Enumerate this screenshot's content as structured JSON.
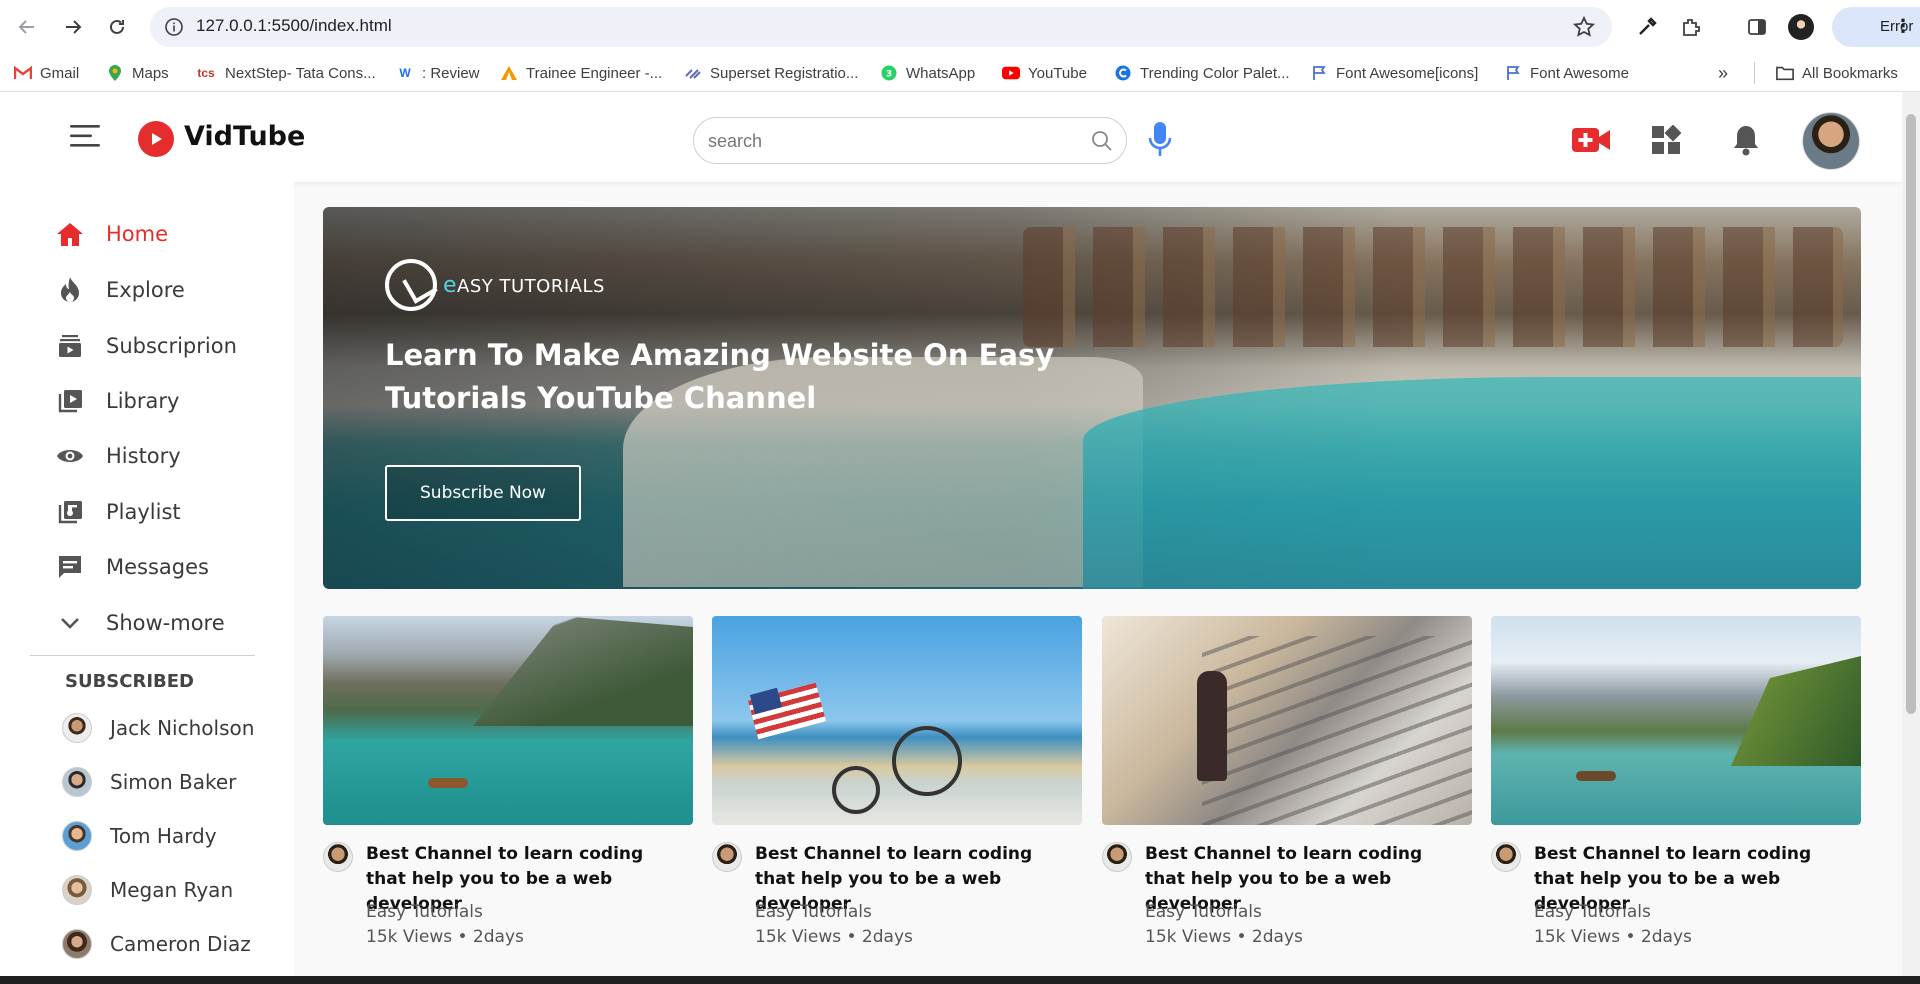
{
  "browser": {
    "url": "127.0.0.1:5500/index.html",
    "profile_status": "Error",
    "bookmarks": [
      {
        "label": "Gmail",
        "icon": "gmail-icon"
      },
      {
        "label": "Maps",
        "icon": "maps-icon"
      },
      {
        "label": "NextStep- Tata Cons...",
        "icon": "tcs-icon"
      },
      {
        "label": ": Review",
        "icon": "w-icon"
      },
      {
        "label": "Trainee Engineer -...",
        "icon": "triangle-icon"
      },
      {
        "label": "Superset Registratio...",
        "icon": "superset-icon"
      },
      {
        "label": "WhatsApp",
        "icon": "whatsapp-icon"
      },
      {
        "label": "YouTube",
        "icon": "youtube-icon"
      },
      {
        "label": "Trending Color Palet...",
        "icon": "c-icon"
      },
      {
        "label": "Font Awesome[icons]",
        "icon": "flag-icon"
      },
      {
        "label": "Font Awesome",
        "icon": "flag-icon"
      }
    ],
    "all_bookmarks": "All Bookmarks"
  },
  "header": {
    "brand": "VidTube",
    "search_placeholder": "search"
  },
  "sidebar": {
    "links": [
      {
        "label": "Home",
        "icon": "home-icon",
        "active": true
      },
      {
        "label": "Explore",
        "icon": "flame-icon",
        "active": false
      },
      {
        "label": "Subscriprion",
        "icon": "subscriptions-icon",
        "active": false
      },
      {
        "label": "Library",
        "icon": "library-icon",
        "active": false
      },
      {
        "label": "History",
        "icon": "eye-icon",
        "active": false
      },
      {
        "label": "Playlist",
        "icon": "playlist-icon",
        "active": false
      },
      {
        "label": "Messages",
        "icon": "chat-icon",
        "active": false
      },
      {
        "label": "Show-more",
        "icon": "chevron-down-icon",
        "active": false
      }
    ],
    "subscribed_heading": "SUBSCRIBED",
    "subscribed": [
      {
        "name": "Jack Nicholson"
      },
      {
        "name": "Simon Baker"
      },
      {
        "name": "Tom Hardy"
      },
      {
        "name": "Megan Ryan"
      },
      {
        "name": "Cameron Diaz"
      }
    ]
  },
  "banner": {
    "brand_first": "e",
    "brand_rest": "ASY TUTORIALS",
    "headline": "Learn To Make Amazing Website On Easy Tutorials YouTube Channel",
    "cta": "Subscribe Now"
  },
  "videos": [
    {
      "title": "Best Channel to learn coding that help you to be a web developer",
      "channel": "Easy Tutorials",
      "meta": "15k Views • 2days"
    },
    {
      "title": "Best Channel to learn coding that help you to be a web developer",
      "channel": "Easy Tutorials",
      "meta": "15k Views • 2days"
    },
    {
      "title": "Best Channel to learn coding that help you to be a web developer",
      "channel": "Easy Tutorials",
      "meta": "15k Views • 2days"
    },
    {
      "title": "Best Channel to learn coding that help you to be a web developer",
      "channel": "Easy Tutorials",
      "meta": "15k Views • 2days"
    }
  ],
  "colors": {
    "accent": "#e52d2d",
    "mic": "#4285f4"
  }
}
